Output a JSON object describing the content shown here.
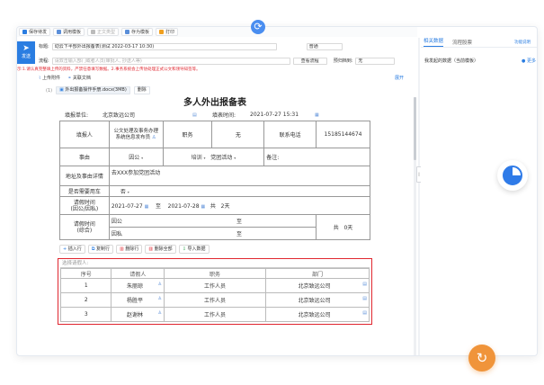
{
  "toolbar": {
    "items": [
      "保存待发",
      "调用模板",
      "正文类型",
      "存为模板",
      "打印"
    ]
  },
  "compose": {
    "send_label": "发送",
    "title_label": "标题:",
    "title_value": "动云下半部外出报备表(测试 2022-03-17 10:30)",
    "priority_value": "普通",
    "flow_label": "流程:",
    "flow_placeholder": "请双击输入部门或者人员(审批人, 抄送人等)",
    "view_flow_button": "查看流程",
    "deadline_label": "预归档到:",
    "deadline_value": "无"
  },
  "warning": "示:1.请认真完整填上传的资料，严禁任意填写数据。2.事务系统会上传协处理正式公文和领导知签等。",
  "attachments": {
    "upload_label": "上传附件",
    "related_label": "关联文档",
    "expand_label": "展开",
    "count_label": "(1)",
    "file_name": "外出报备操作手册.docx(3MB)",
    "delete_label": "删除"
  },
  "form": {
    "title": "多人外出报备表",
    "unit_label": "填报单位:",
    "unit_value": "北京致远公司",
    "time_label": "填表时间:",
    "time_value": "2021-07-27 15:31",
    "filler_label": "填报人",
    "filler_value": "公文处理及事务办理系统信息发布员",
    "position_label": "职务",
    "position_value": "无",
    "phone_label": "联系电话",
    "phone_value": "15185144674",
    "matter_label": "事由",
    "matter_type": "因公",
    "matter_sub": "培训",
    "matter_sub2": "党团活动",
    "note_label": "备注:",
    "address_label": "地址及事由详情",
    "address_value": "去XXX参加党团活动",
    "car_label": "是否需要用车",
    "car_value": "否",
    "leave_label": "请假时间\n(因公/因私)",
    "leave_from": "2021-07-27",
    "leave_to_label": "至",
    "leave_to": "2021-07-28",
    "leave_total_label": "共",
    "leave_total": "2天",
    "leave2_label": "请假时间\n(综合)",
    "public_label": "因公",
    "private_label": "因私",
    "to_label": "至",
    "total_label": "共",
    "total_value": "0天"
  },
  "ops": {
    "insert": "插入行",
    "copy": "复制行",
    "delete": "删除行",
    "delete_all": "删除全部",
    "import": "导入数据"
  },
  "people": {
    "caption": "选择请假人:",
    "headers": [
      "序号",
      "请假人",
      "职务",
      "部门"
    ],
    "rows": [
      {
        "no": "1",
        "name": "朱丽琼",
        "position": "工作人员",
        "dept": "北京致远公司"
      },
      {
        "no": "2",
        "name": "杨胜平",
        "position": "工作人员",
        "dept": "北京致远公司"
      },
      {
        "no": "3",
        "name": "赵谢林",
        "position": "工作人员",
        "dept": "北京致远公司"
      }
    ]
  },
  "right_panel": {
    "tab_related": "相关数据",
    "tab_flow": "流程股票",
    "link": "功能说明",
    "item_label": "我发起的数据（当前模板）",
    "more": "更多"
  },
  "colors": {
    "accent": "#2a7de1",
    "warning": "#e0262f",
    "float_orange": "#f0943a"
  }
}
